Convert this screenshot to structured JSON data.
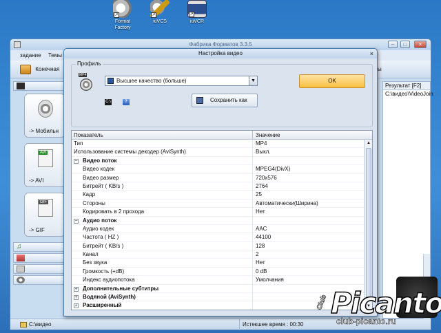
{
  "desktop": {
    "icons": [
      {
        "label1": "Format",
        "label2": "Factory"
      },
      {
        "label1": "iuVCS",
        "label2": ""
      },
      {
        "label1": "iuVCR",
        "label2": ""
      }
    ]
  },
  "main_window": {
    "title": "Фабрика Форматов 3.3.5",
    "menu": [
      "задание",
      "Темы"
    ],
    "toolbar_label": "Конечная",
    "toolbar_right_label": "ммы",
    "converters": [
      {
        "label": "-> Мобильн",
        "tag": ""
      },
      {
        "label": "-> AVI",
        "tag": "AVI"
      },
      {
        "label": "-> GIF",
        "tag": "GIF"
      }
    ],
    "right_pane": {
      "header": "Результат [F2]",
      "row1": "C:\\видео\\VideoJoin"
    },
    "status": {
      "path": "C:\\видео",
      "elapsed": "Истекшее время : 00:30"
    }
  },
  "dialog": {
    "title": "Настройка видео",
    "profile_legend": "Профиль",
    "profile_icon_tag": "MP4",
    "profile_value": "Высшее качество (больше)",
    "ok_label": "OK",
    "save_label": "Сохранить как",
    "cmd_icon": "C:\\",
    "help_icon": "?",
    "grid": {
      "col1": "Показатель",
      "col2": "Значение",
      "rows": [
        {
          "k": "Тип",
          "v": "MP4"
        },
        {
          "k": "Использование системы декодер (AviSynth)",
          "v": "Выкл."
        },
        {
          "k": "Видео поток",
          "v": "",
          "group": "−"
        },
        {
          "k": "Видео кодек",
          "v": "MPEG4(DivX)"
        },
        {
          "k": "Видео размер",
          "v": "720x576"
        },
        {
          "k": "Битрейт ( KB/s )",
          "v": "2764"
        },
        {
          "k": "Кадр",
          "v": "25"
        },
        {
          "k": "Стороны",
          "v": "Автоматически(Ширина)"
        },
        {
          "k": "Кодировать в 2 прохода",
          "v": "Нет"
        },
        {
          "k": "Аудио поток",
          "v": "",
          "group": "−"
        },
        {
          "k": "Аудио кодек",
          "v": "AAC"
        },
        {
          "k": "Частота ( HZ )",
          "v": "44100"
        },
        {
          "k": "Битрейт ( KB/s )",
          "v": "128"
        },
        {
          "k": "Канал",
          "v": "2"
        },
        {
          "k": "Без звука",
          "v": "Нет"
        },
        {
          "k": "Громкость (+dB)",
          "v": "0 dB"
        },
        {
          "k": "Индекс аудиопотока",
          "v": "Умолчания"
        },
        {
          "k": "Дополнительные субтитры",
          "v": "",
          "group": "+"
        },
        {
          "k": "Водяной (AviSynth)",
          "v": "",
          "group": "+"
        },
        {
          "k": "Расширенный",
          "v": "",
          "group": "+"
        }
      ]
    }
  },
  "watermark": {
    "brand": "Picanto",
    "club": "Club",
    "url": "club-picanto.ru"
  }
}
